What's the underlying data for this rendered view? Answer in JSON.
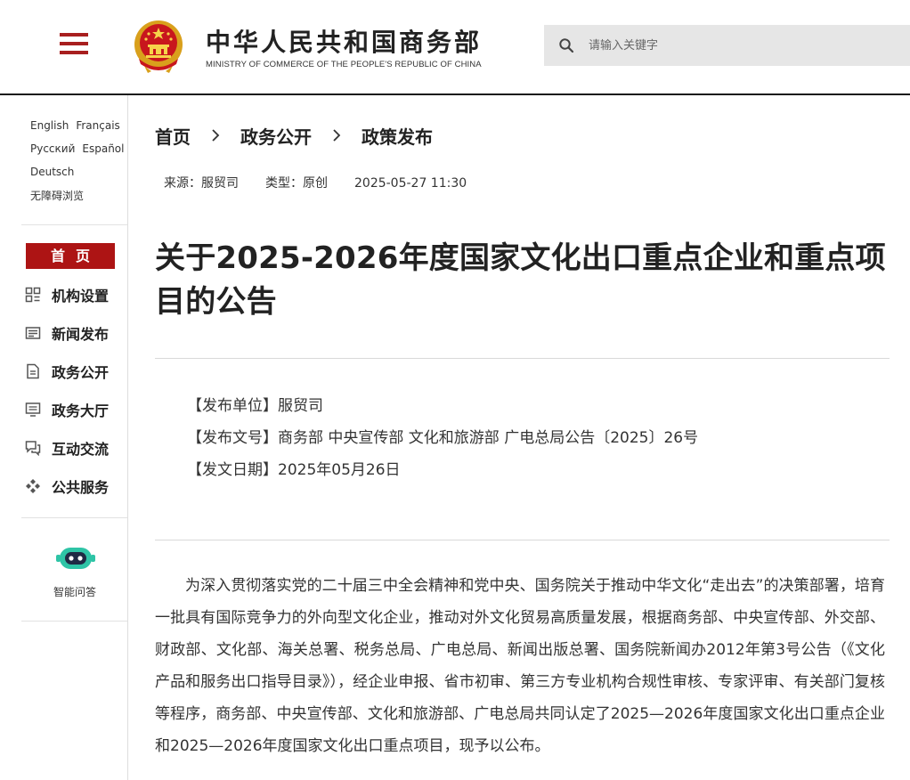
{
  "header": {
    "title": "中华人民共和国商务部",
    "subtitle": "MINISTRY OF COMMERCE OF THE PEOPLE'S REPUBLIC OF CHINA",
    "search_placeholder": "请输入关键字",
    "accent_color": "#a81f1f"
  },
  "sidebar": {
    "languages_row1": [
      "English",
      "Français"
    ],
    "languages_row2": [
      "Русский",
      "Español"
    ],
    "languages_row3": [
      "Deutsch"
    ],
    "accessibility": "无障碍浏览",
    "home": "首页",
    "items": [
      {
        "label": "机构设置",
        "icon": "org-structure-icon"
      },
      {
        "label": "新闻发布",
        "icon": "news-icon"
      },
      {
        "label": "政务公开",
        "icon": "document-icon"
      },
      {
        "label": "政务大厅",
        "icon": "monitor-icon"
      },
      {
        "label": "互动交流",
        "icon": "chat-icon"
      },
      {
        "label": "公共服务",
        "icon": "service-icon"
      }
    ],
    "assistant_label": "智能问答"
  },
  "breadcrumb": [
    "首页",
    "政务公开",
    "政策发布"
  ],
  "meta": {
    "source": "来源：服贸司",
    "type": "类型：原创",
    "datetime": "2025-05-27 11:30"
  },
  "article": {
    "title": "关于2025-2026年度国家文化出口重点企业和重点项目的公告",
    "publisher": "【发布单位】服贸司",
    "doc_number": "【发布文号】商务部 中央宣传部 文化和旅游部 广电总局公告〔2025〕26号",
    "issue_date": "【发文日期】2025年05月26日",
    "body": "为深入贯彻落实党的二十届三中全会精神和党中央、国务院关于推动中华文化“走出去”的决策部署，培育一批具有国际竞争力的外向型文化企业，推动对外文化贸易高质量发展，根据商务部、中央宣传部、外交部、财政部、文化部、海关总署、税务总局、广电总局、新闻出版总署、国务院新闻办2012年第3号公告（《文化产品和服务出口指导目录》），经企业申报、省市初审、第三方专业机构合规性审核、专家评审、有关部门复核等程序，商务部、中央宣传部、文化和旅游部、广电总局共同认定了2025—2026年度国家文化出口重点企业和2025—2026年度国家文化出口重点项目，现予以公布。"
  }
}
